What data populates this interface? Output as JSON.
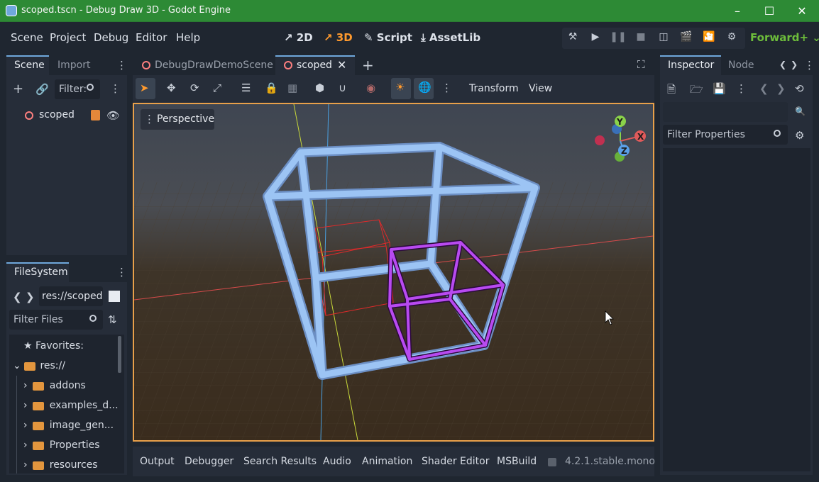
{
  "window": {
    "title": "scoped.tscn - Debug Draw 3D - Godot Engine"
  },
  "menu": {
    "items": [
      "Scene",
      "Project",
      "Debug",
      "Editor",
      "Help"
    ]
  },
  "modes": {
    "m2d": "2D",
    "m3d": "3D",
    "script": "Script",
    "assetlib": "AssetLib"
  },
  "renderer": "Forward+",
  "scene_dock": {
    "tab_scene": "Scene",
    "tab_import": "Import",
    "filter_placeholder": "Filter:",
    "root_node": "scoped"
  },
  "filesystem": {
    "tab": "FileSystem",
    "path": "res://scoped",
    "filter_placeholder": "Filter Files",
    "favorites": "Favorites:",
    "root": "res://",
    "folders": [
      "addons",
      "examples_d...",
      "image_gen...",
      "Properties",
      "resources"
    ]
  },
  "editor_tabs": {
    "tab1": "DebugDrawDemoScene",
    "tab2": "scoped"
  },
  "viewport_toolbar": {
    "transform": "Transform",
    "view": "View",
    "perspective": "Perspective"
  },
  "gizmo": {
    "y": "Y",
    "x": "X",
    "z": "Z"
  },
  "inspector": {
    "tab_inspector": "Inspector",
    "tab_node": "Node",
    "filter_placeholder": "Filter Properties"
  },
  "bottom_panel": {
    "tabs": [
      "Output",
      "Debugger",
      "Search Results",
      "Audio",
      "Animation",
      "Shader Editor",
      "MSBuild"
    ],
    "version": "4.2.1.stable.mono"
  },
  "colors": {
    "title_green": "#2d8a35",
    "accent_orange": "#ff9a2e",
    "viewport_border": "#e8a04a",
    "cube_blue": "#8fb9f0",
    "cube_purple": "#b038e8",
    "cube_red": "#e02a2a"
  }
}
